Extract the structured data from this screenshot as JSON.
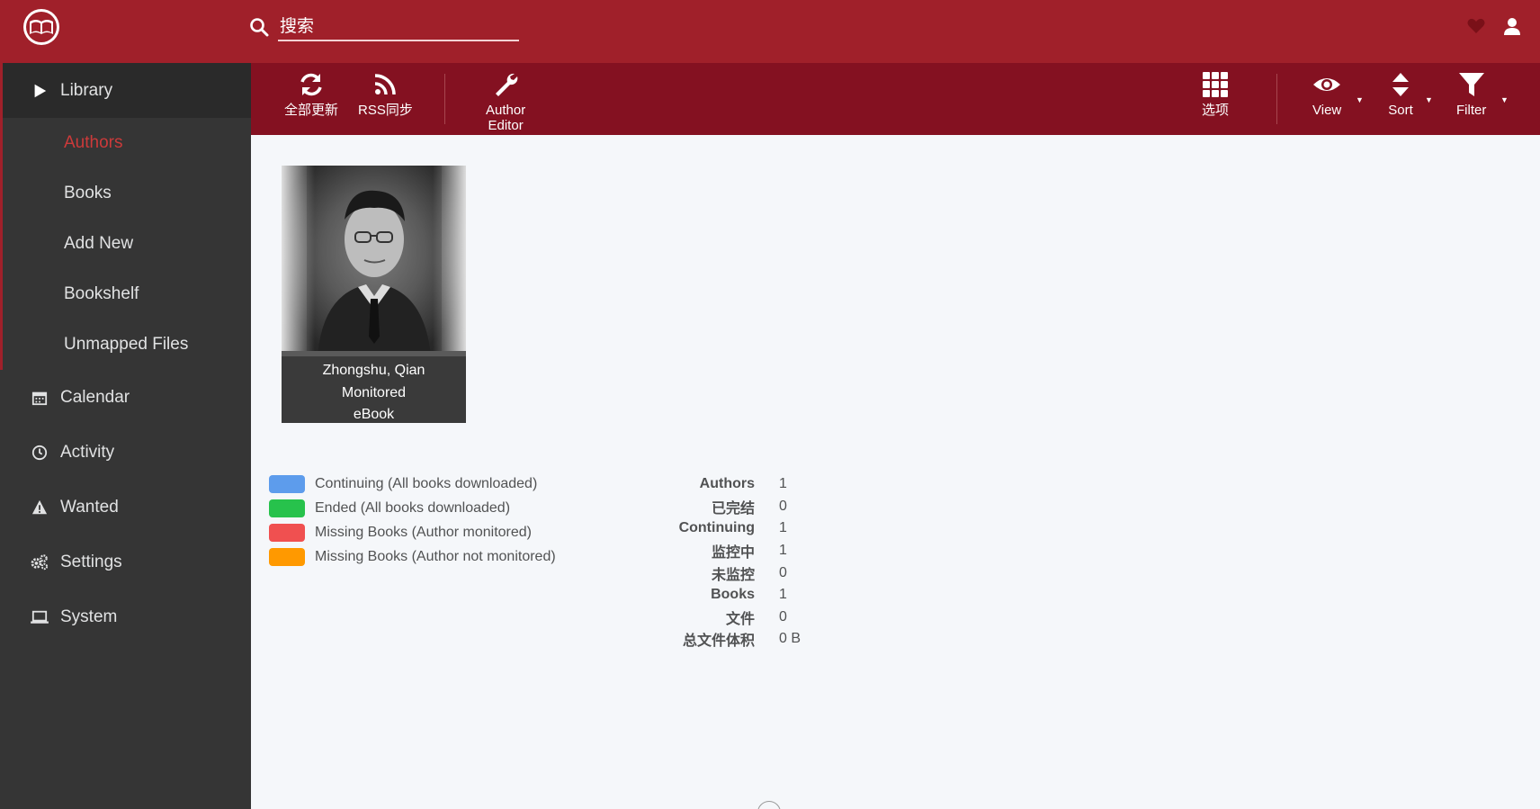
{
  "header": {
    "search_placeholder": "搜索"
  },
  "sidebar": {
    "library": "Library",
    "sub_items": [
      "Authors",
      "Books",
      "Add New",
      "Bookshelf",
      "Unmapped Files"
    ],
    "calendar": "Calendar",
    "activity": "Activity",
    "wanted": "Wanted",
    "settings": "Settings",
    "system": "System"
  },
  "toolbar": {
    "update_all": "全部更新",
    "rss_sync": "RSS同步",
    "author_editor_line1": "Author",
    "author_editor_line2": "Editor",
    "options": "选项",
    "view": "View",
    "sort": "Sort",
    "filter": "Filter"
  },
  "author": {
    "name": "Zhongshu, Qian",
    "status": "Monitored",
    "profile": "eBook"
  },
  "legend": [
    {
      "label": "Continuing (All books downloaded)",
      "color": "#5d9cec"
    },
    {
      "label": "Ended (All books downloaded)",
      "color": "#27c24c"
    },
    {
      "label": "Missing Books (Author monitored)",
      "color": "#f05050"
    },
    {
      "label": "Missing Books (Author not monitored)",
      "color": "#ff9900"
    }
  ],
  "stats": [
    {
      "label": "Authors",
      "value": "1"
    },
    {
      "label": "已完结",
      "value": "0"
    },
    {
      "label": "Continuing",
      "value": "1"
    },
    {
      "label": "监控中",
      "value": "1"
    },
    {
      "label": "未监控",
      "value": "0"
    },
    {
      "label": "Books",
      "value": "1"
    },
    {
      "label": "文件",
      "value": "0"
    },
    {
      "label": "总文件体积",
      "value": "0 B"
    }
  ],
  "colors": {
    "header": "#a0202a",
    "toolbar": "#841121",
    "sidebar": "#353535",
    "accent": "#cc3a3a"
  }
}
